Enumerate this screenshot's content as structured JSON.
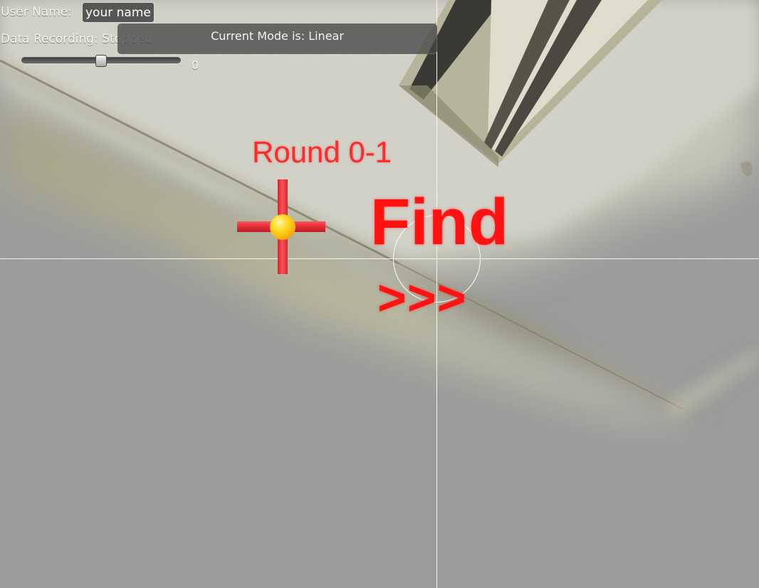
{
  "hud": {
    "user_name_label": "User Name:",
    "user_name_value": "your name",
    "recording_label": "Data Recording: Stopped",
    "mode_label": "Current Mode is: Linear",
    "slider_value": "0",
    "slider_fraction": 0.5
  },
  "game": {
    "round_label": "Round 0-1",
    "instruction": "Find",
    "direction_arrows": ">>>"
  },
  "icons": {
    "target": "red-cross-with-yellow-sphere",
    "crosshair": "white-crosshair-with-circle"
  },
  "colors": {
    "prompt_red": "#ff1212",
    "background_gray": "#9b9b9b",
    "crosshair_white": "#f5f5f5"
  }
}
